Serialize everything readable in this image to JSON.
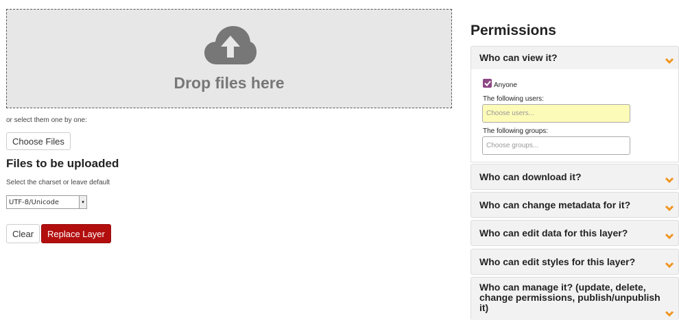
{
  "upload": {
    "drop_text": "Drop files here",
    "or_select": "or select them one by one:",
    "choose_files": "Choose Files",
    "files_heading": "Files to be uploaded",
    "charset_label": "Select the charset or leave default",
    "charset_value": "UTF-8/Unicode",
    "clear_label": "Clear",
    "replace_label": "Replace Layer"
  },
  "permissions": {
    "title": "Permissions",
    "view": {
      "title": "Who can view it?",
      "anyone_label": "Anyone",
      "anyone_checked": true,
      "users_label": "The following users:",
      "users_placeholder": "Choose users...",
      "groups_label": "The following groups:",
      "groups_placeholder": "Choose groups..."
    },
    "download_title": "Who can download it?",
    "metadata_title": "Who can change metadata for it?",
    "edit_data_title": "Who can edit data for this layer?",
    "edit_styles_title": "Who can edit styles for this layer?",
    "manage_title": "Who can manage it? (update, delete, change permissions, publish/unpublish it)"
  },
  "colors": {
    "accent_chevron": "#f0941e",
    "replace_button": "#b30e0e",
    "checkbox": "#8e4785"
  }
}
